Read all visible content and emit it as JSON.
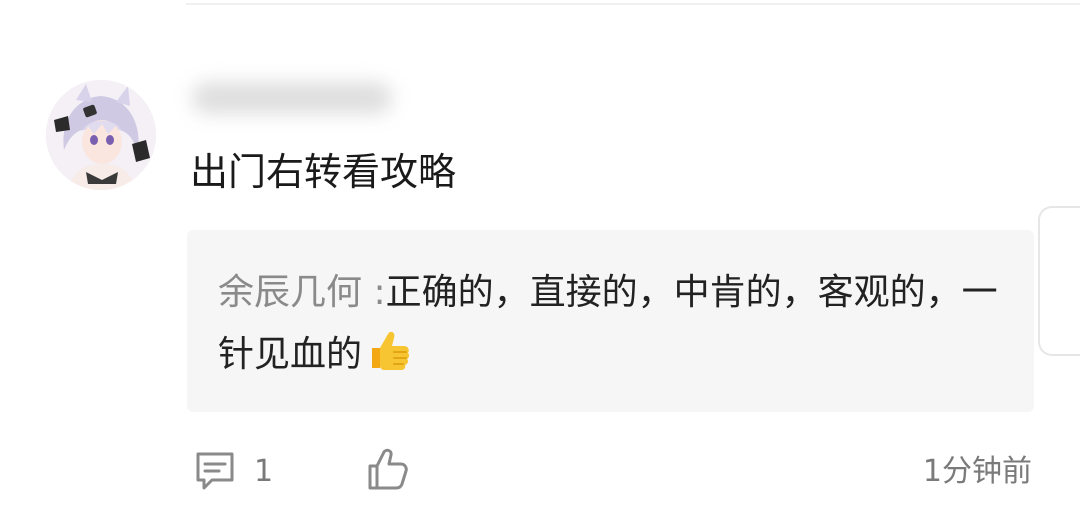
{
  "comment": {
    "username": "",
    "text": "出门右转看攻略",
    "avatar_icon": "anime-avatar"
  },
  "reply": {
    "author": "余辰几何",
    "separator": ":",
    "text_line": "正确的，直接的，中肯的，客观的，一针见血的",
    "emoji": "thumbs-up-emoji"
  },
  "footer": {
    "reply_count": "1",
    "timestamp": "1分钟前",
    "reply_icon": "comment-icon",
    "like_icon": "thumbs-up-icon"
  },
  "colors": {
    "text_primary": "#1a1a1a",
    "text_secondary": "#8a8a8a",
    "reply_background": "#f6f6f6",
    "emoji_yellow": "#f7b928"
  }
}
